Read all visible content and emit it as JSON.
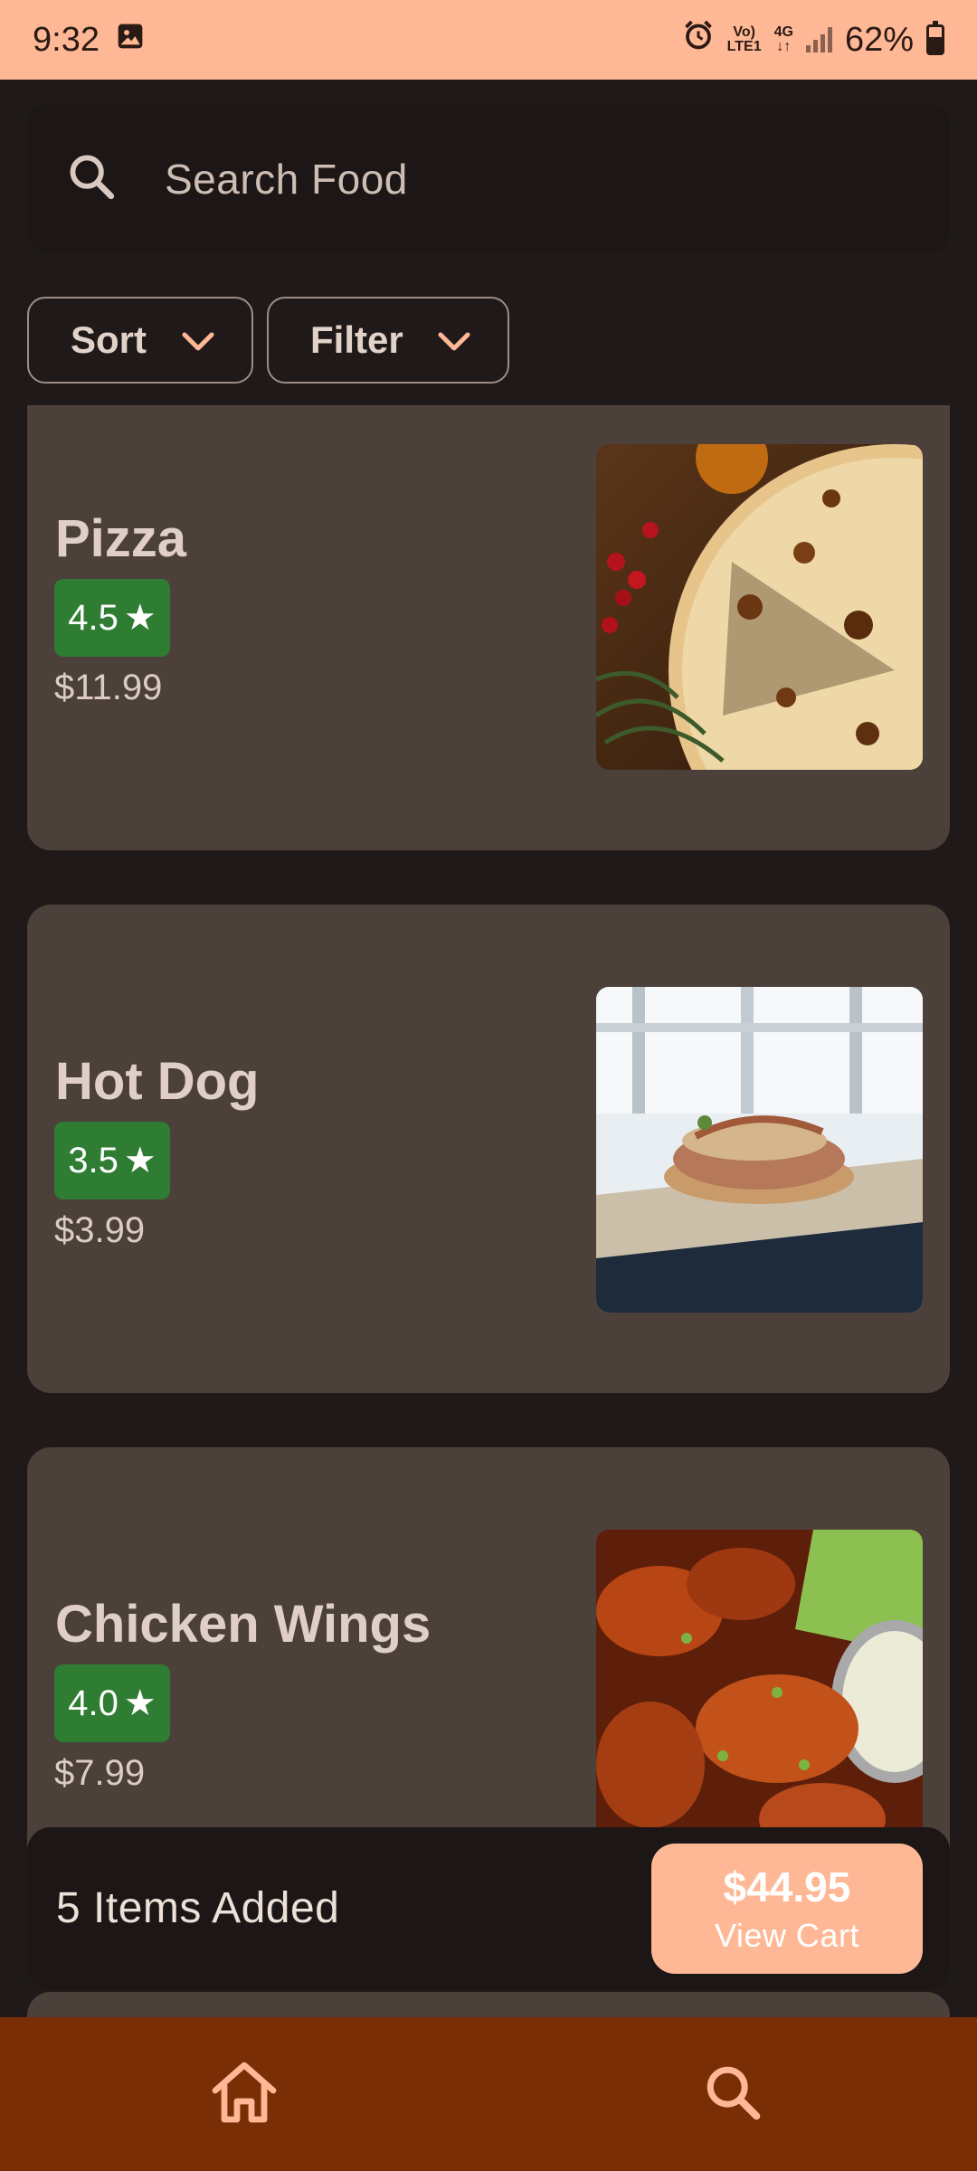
{
  "status_bar": {
    "time": "9:32",
    "network_top": "Vo)",
    "network_bottom": "LTE1",
    "network_type": "4G",
    "battery": "62%"
  },
  "search": {
    "placeholder": "Search Food",
    "icon": "search-icon"
  },
  "controls": {
    "sort_label": "Sort",
    "filter_label": "Filter"
  },
  "foods": [
    {
      "name": "Pizza",
      "rating": "4.5",
      "price": "$11.99"
    },
    {
      "name": "Hot Dog",
      "rating": "3.5",
      "price": "$3.99"
    },
    {
      "name": "Chicken Wings",
      "rating": "4.0",
      "price": "$7.99"
    }
  ],
  "cart": {
    "items_added": "5 Items Added",
    "total": "$44.95",
    "button_label": "View Cart"
  },
  "bottom_nav": {
    "items": [
      "home-icon",
      "search-icon"
    ]
  },
  "colors": {
    "accent": "#ffb896",
    "background": "#1f1a19",
    "card": "#4c403b",
    "rating_green": "#2e7d32",
    "nav_bar": "#7a2e05"
  }
}
